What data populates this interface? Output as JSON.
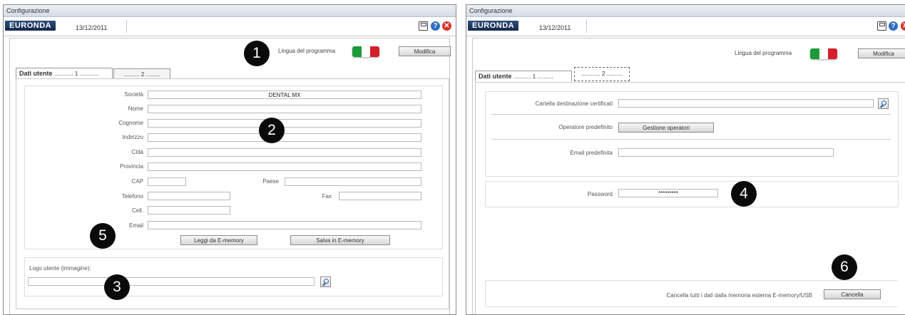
{
  "left_window": {
    "title": "Configurazione",
    "logo": "EURONDA",
    "date": "13/12/2011",
    "language_label": "Lingua del programma",
    "modify_button": "Modifica",
    "tabs": [
      {
        "label": "Dati utente",
        "deco": "............ 1 ............"
      },
      {
        "label": "",
        "deco": ".......... 2 ........."
      }
    ],
    "fields": {
      "societa": {
        "label": "Società",
        "value": "DENTAL MX"
      },
      "nome": {
        "label": "Nome",
        "value": ""
      },
      "cognome": {
        "label": "Cognome",
        "value": ""
      },
      "indirizzo": {
        "label": "Indirizzo",
        "value": ""
      },
      "citta": {
        "label": "Città",
        "value": ""
      },
      "provincia": {
        "label": "Provincia",
        "value": ""
      },
      "cap": {
        "label": "CAP",
        "value": ""
      },
      "paese": {
        "label": "Paese",
        "value": ""
      },
      "telefono": {
        "label": "Telefono",
        "value": ""
      },
      "fax": {
        "label": "Fax",
        "value": ""
      },
      "cell": {
        "label": "Cell.",
        "value": ""
      },
      "email": {
        "label": "Email",
        "value": ""
      }
    },
    "read_button": "Leggi da E-memory",
    "save_button": "Salva in E-memory",
    "logo_section_label": "Logo utente (immagine):",
    "logo_path_value": ""
  },
  "right_window": {
    "title": "Configurazione",
    "logo": "EURONDA",
    "date": "13/12/2011",
    "language_label": "Lingua del programma",
    "modify_button": "Modifica",
    "tabs": [
      {
        "label": "Dati utente",
        "deco": "........... 1 .........."
      },
      {
        "label": "",
        "deco": "............ 2 .........."
      }
    ],
    "cert_folder_label": "Cartella destinazione certificati",
    "cert_folder_value": "",
    "default_operator_label": "Operatore predefinito",
    "manage_operators_button": "Gestione operatori",
    "default_email_label": "Email predefinita",
    "default_email_value": "",
    "password_label": "Password",
    "password_value": "*********",
    "clear_label": "Cancella tutti i dati dalla memoria esterna E-memory/USB",
    "clear_button": "Cancella"
  },
  "badges": [
    "1",
    "2",
    "3",
    "4",
    "5",
    "6"
  ],
  "flag_colors": [
    "#1d9a3a",
    "#ffffff",
    "#d4202c"
  ],
  "icons": [
    "save-icon",
    "help-icon",
    "close-icon",
    "search-icon",
    "italian-flag-icon"
  ]
}
